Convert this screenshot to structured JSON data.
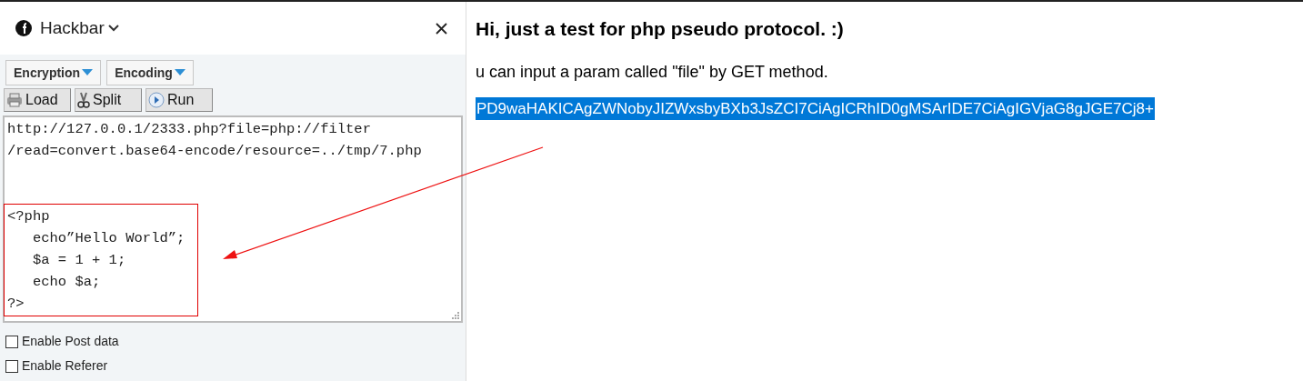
{
  "panel": {
    "title": "Hackbar",
    "menus": [
      "Encryption",
      "Encoding"
    ],
    "buttons": [
      {
        "kind": "load",
        "label": "Load"
      },
      {
        "kind": "split",
        "label": "Split"
      },
      {
        "kind": "run",
        "label": "Run"
      }
    ],
    "url_lines": [
      "http://127.0.0.1/2333.php?file=php://filter",
      "/read=convert.base64-encode/resource=../tmp/7.php"
    ],
    "code_lines": [
      "<?php",
      "   echo”Hello World”;",
      "   $a = 1 + 1;",
      "   echo $a;",
      "?>"
    ],
    "options": [
      {
        "label": "Enable Post data",
        "checked": false
      },
      {
        "label": "Enable Referer",
        "checked": false
      }
    ]
  },
  "page": {
    "heading": "Hi, just a test for php pseudo protocol. :)",
    "text": "u can input a param called \"file\" by GET method.",
    "output": {
      "text": "PD9waHAKICAgZWNobyJIZWxsbyBXb3JsZCI7CiAgICRhID0gMSArIDE7CiAgIGVjaG8gJGE7Cj8+",
      "selected": true
    }
  }
}
